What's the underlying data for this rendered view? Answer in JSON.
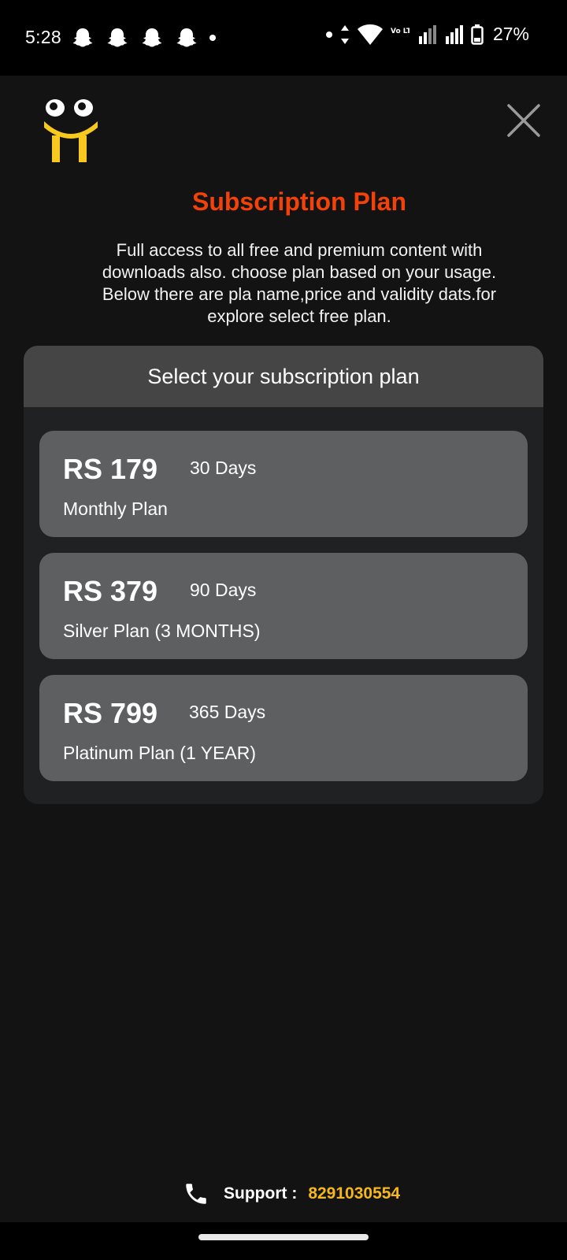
{
  "status_bar": {
    "time": "5:28",
    "battery_percent": "27%",
    "volte_label": "Vo LTE2",
    "notification_icons": [
      "snapchat-icon",
      "snapchat-icon",
      "snapchat-icon",
      "snapchat-icon"
    ]
  },
  "header": {
    "title": "Subscription Plan",
    "description": "Full access to all free and premium content with downloads also. choose plan based on your usage. Below there are pla name,price and validity dats.for explore select free plan."
  },
  "plans_panel": {
    "heading": "Select your subscription plan",
    "plans": [
      {
        "price": "RS 179",
        "validity": "30 Days",
        "name": "Monthly Plan"
      },
      {
        "price": "RS 379",
        "validity": "90 Days",
        "name": "Silver Plan (3 MONTHS)"
      },
      {
        "price": "RS 799",
        "validity": "365 Days",
        "name": "Platinum Plan (1 YEAR)"
      }
    ]
  },
  "support": {
    "label": "Support :",
    "number": "8291030554"
  },
  "colors": {
    "title": "#f2420a",
    "support_number": "#f5b71b",
    "logo_yellow": "#f7c81e"
  }
}
